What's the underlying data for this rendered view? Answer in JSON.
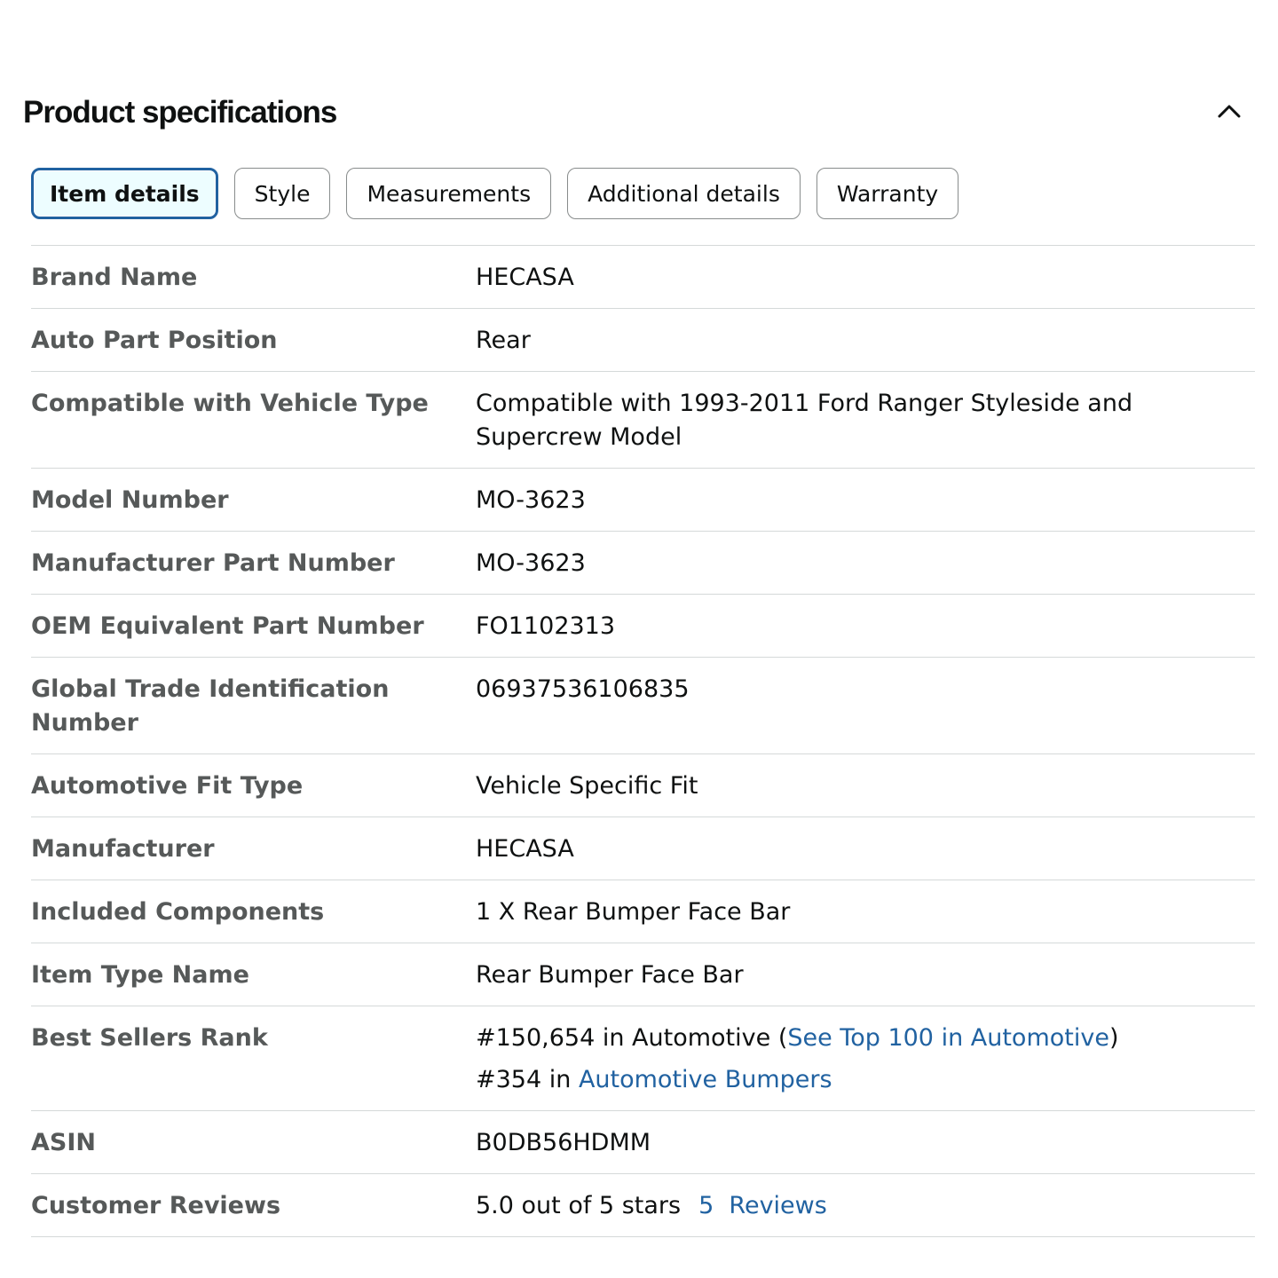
{
  "section": {
    "title": "Product specifications"
  },
  "tabs": [
    {
      "label": "Item details",
      "active": true
    },
    {
      "label": "Style",
      "active": false
    },
    {
      "label": "Measurements",
      "active": false
    },
    {
      "label": "Additional details",
      "active": false
    },
    {
      "label": "Warranty",
      "active": false
    }
  ],
  "specs": {
    "brand_name": {
      "label": "Brand Name",
      "value": "HECASA"
    },
    "auto_part_position": {
      "label": "Auto Part Position",
      "value": "Rear"
    },
    "compatible_vehicle_type": {
      "label": "Compatible with Vehicle Type",
      "value": "Compatible with 1993-2011 Ford Ranger Styleside and Supercrew Model"
    },
    "model_number": {
      "label": "Model Number",
      "value": "MO-3623"
    },
    "manufacturer_part_number": {
      "label": "Manufacturer Part Number",
      "value": "MO-3623"
    },
    "oem_equivalent_part_number": {
      "label": "OEM Equivalent Part Number",
      "value": "FO1102313"
    },
    "gtin": {
      "label": "Global Trade Identification Number",
      "value": "06937536106835"
    },
    "automotive_fit_type": {
      "label": "Automotive Fit Type",
      "value": "Vehicle Specific Fit"
    },
    "manufacturer": {
      "label": "Manufacturer",
      "value": "HECASA"
    },
    "included_components": {
      "label": "Included Components",
      "value": "1 X Rear Bumper Face Bar"
    },
    "item_type_name": {
      "label": "Item Type Name",
      "value": "Rear Bumper Face Bar"
    },
    "best_sellers_rank": {
      "label": "Best Sellers Rank",
      "line1_prefix": "#150,654 in Automotive (",
      "line1_link": "See Top 100 in Automotive",
      "line1_suffix": ")",
      "line2_prefix": "#354 in ",
      "line2_link": "Automotive Bumpers"
    },
    "asin": {
      "label": "ASIN",
      "value": "B0DB56HDMM"
    },
    "customer_reviews": {
      "label": "Customer Reviews",
      "rating_text": "5.0 out of 5 stars",
      "reviews_count": "5",
      "reviews_label": "Reviews"
    }
  },
  "icons": {
    "collapse": "chevron-up-icon"
  },
  "colors": {
    "link": "#2162a1",
    "label": "#565959",
    "active_tab_border": "#2162a1",
    "active_tab_background": "#edfdff",
    "divider": "#d5d9d9"
  }
}
